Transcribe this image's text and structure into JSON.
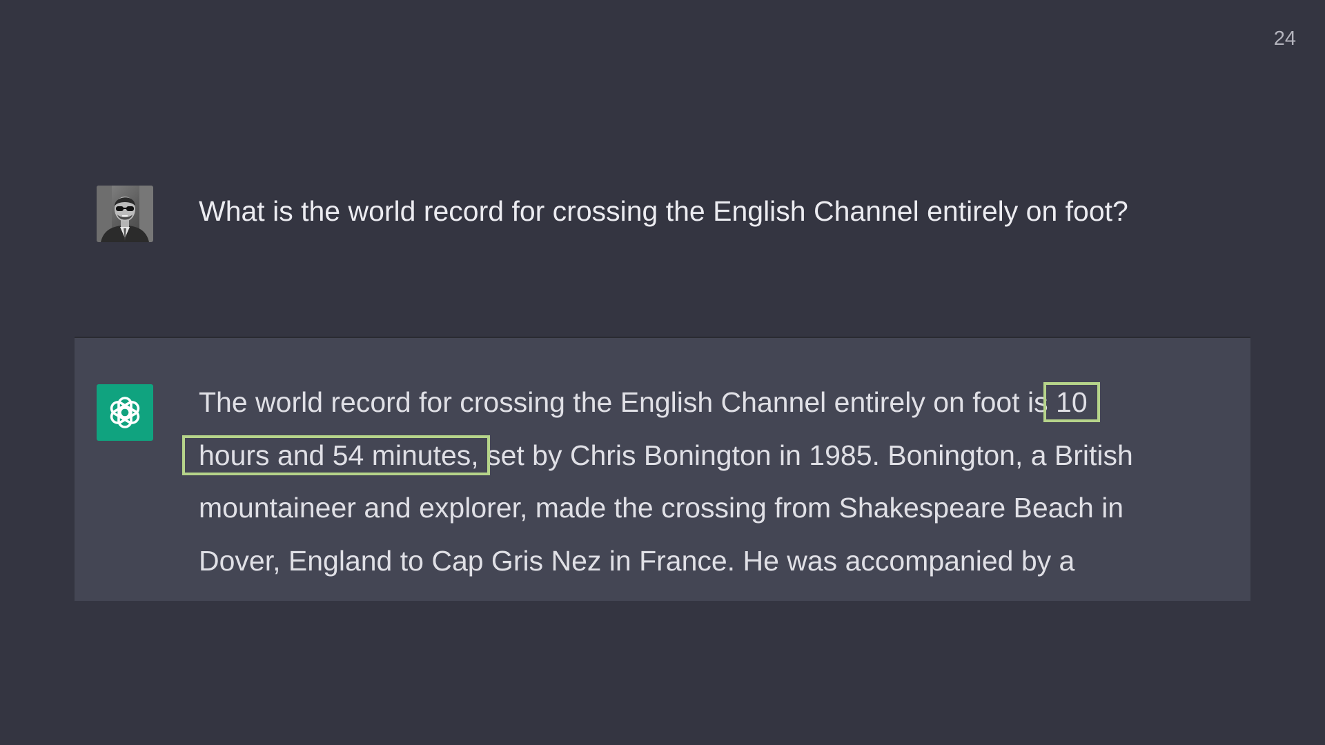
{
  "slide": {
    "page_number": "24"
  },
  "user_message": {
    "avatar_icon": "user-avatar-photo",
    "text": "What is the world record for crossing the English Channel entirely on foot?"
  },
  "assistant_message": {
    "icon": "openai-logo-icon",
    "icon_bg_color": "#10a37f",
    "highlight_color": "#b6d48a",
    "lines": {
      "line1_before": "The world record for crossing the English Channel entirely on foot is ",
      "line1_highlight": "10",
      "line2_highlight": "hours and 54 minutes,",
      "line2_after": " set by Chris Bonington in 1985. Bonington, a British",
      "line3": "mountaineer and explorer, made the crossing from Shakespeare Beach in",
      "line4": "Dover, England to Cap Gris Nez in France. He was accompanied by a"
    }
  }
}
